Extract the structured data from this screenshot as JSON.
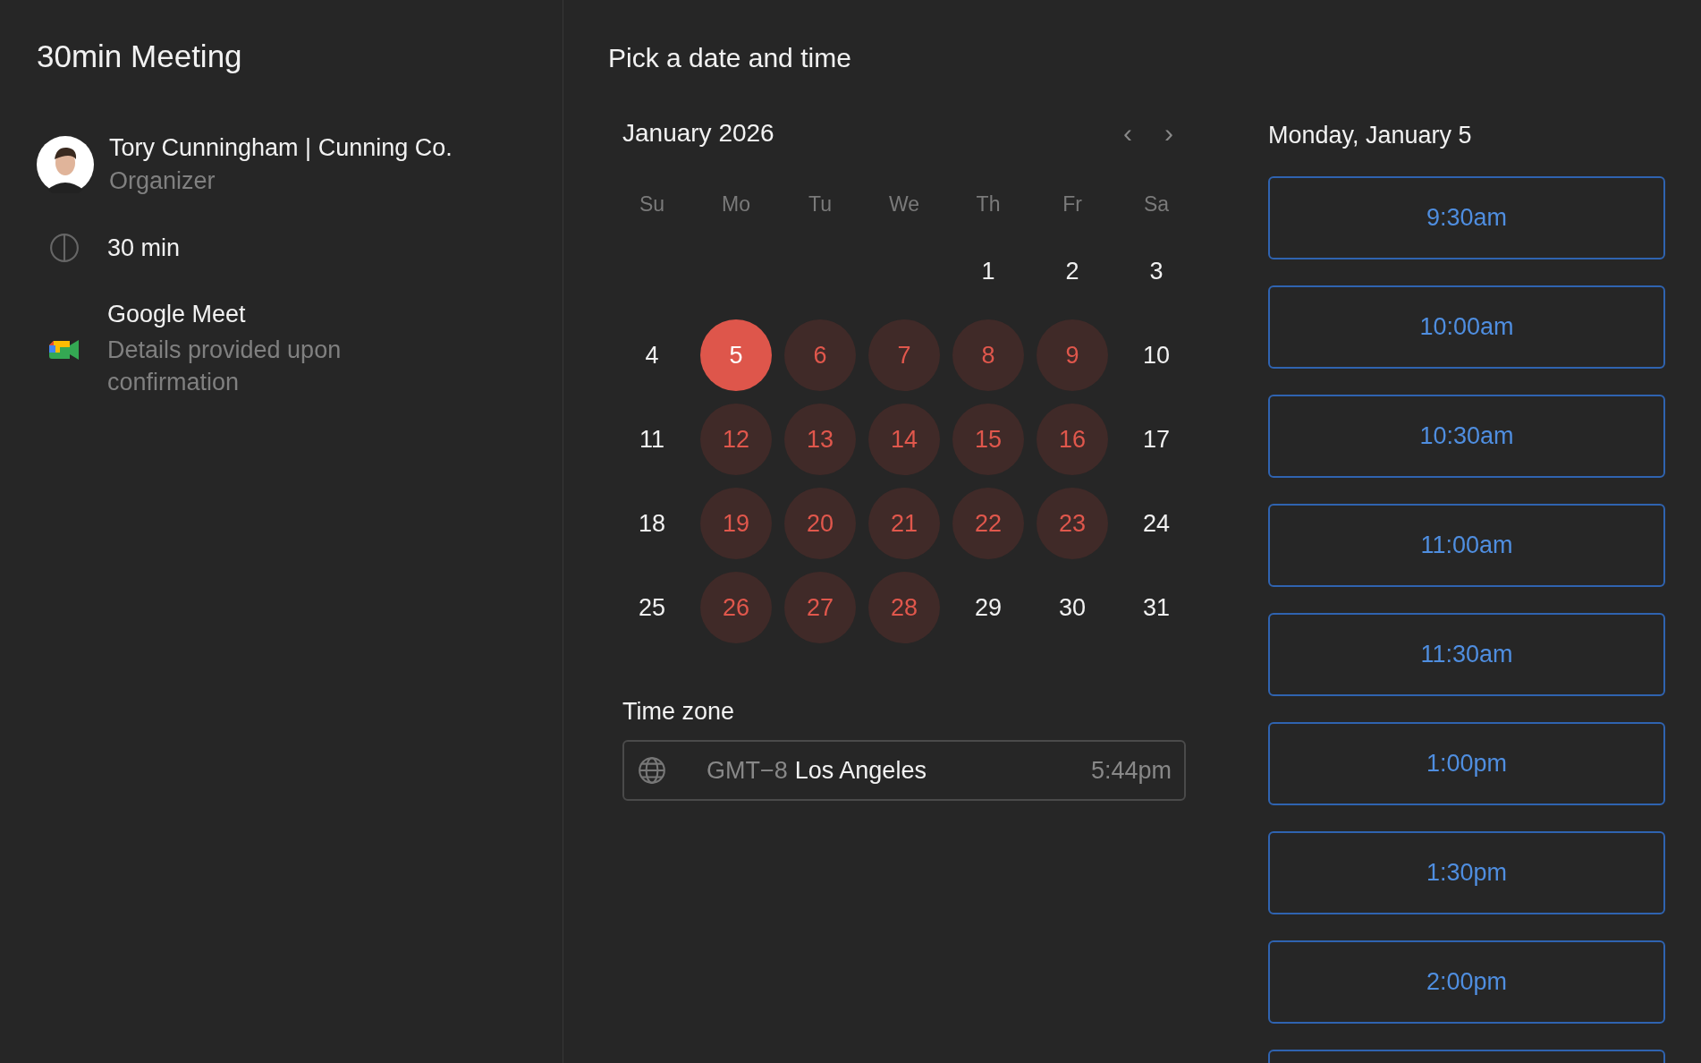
{
  "event": {
    "title": "30min Meeting",
    "organizer": {
      "name": "Tory Cunningham | Cunning Co.",
      "role": "Organizer"
    },
    "duration": "30 min",
    "location": {
      "name": "Google Meet",
      "note": "Details provided upon confirmation"
    }
  },
  "booking": {
    "title": "Pick a date and time",
    "calendar": {
      "month": "January 2026",
      "prev": "‹",
      "next": "›",
      "weekdays": [
        "Su",
        "Mo",
        "Tu",
        "We",
        "Th",
        "Fr",
        "Sa"
      ],
      "weeks": [
        [
          {
            "day": "1",
            "available": false,
            "selected": false
          },
          {
            "day": "2",
            "available": false,
            "selected": false
          },
          {
            "day": "3",
            "available": false,
            "selected": false
          }
        ],
        [
          {
            "day": "4",
            "available": false,
            "selected": false
          },
          {
            "day": "5",
            "available": true,
            "selected": true
          },
          {
            "day": "6",
            "available": true,
            "selected": false
          },
          {
            "day": "7",
            "available": true,
            "selected": false
          },
          {
            "day": "8",
            "available": true,
            "selected": false
          },
          {
            "day": "9",
            "available": true,
            "selected": false
          },
          {
            "day": "10",
            "available": false,
            "selected": false
          }
        ],
        [
          {
            "day": "11",
            "available": false,
            "selected": false
          },
          {
            "day": "12",
            "available": true,
            "selected": false
          },
          {
            "day": "13",
            "available": true,
            "selected": false
          },
          {
            "day": "14",
            "available": true,
            "selected": false
          },
          {
            "day": "15",
            "available": true,
            "selected": false
          },
          {
            "day": "16",
            "available": true,
            "selected": false
          },
          {
            "day": "17",
            "available": false,
            "selected": false
          }
        ],
        [
          {
            "day": "18",
            "available": false,
            "selected": false
          },
          {
            "day": "19",
            "available": true,
            "selected": false
          },
          {
            "day": "20",
            "available": true,
            "selected": false
          },
          {
            "day": "21",
            "available": true,
            "selected": false
          },
          {
            "day": "22",
            "available": true,
            "selected": false
          },
          {
            "day": "23",
            "available": true,
            "selected": false
          },
          {
            "day": "24",
            "available": false,
            "selected": false
          }
        ],
        [
          {
            "day": "25",
            "available": false,
            "selected": false
          },
          {
            "day": "26",
            "available": true,
            "selected": false
          },
          {
            "day": "27",
            "available": true,
            "selected": false
          },
          {
            "day": "28",
            "available": true,
            "selected": false
          },
          {
            "day": "29",
            "available": false,
            "selected": false
          },
          {
            "day": "30",
            "available": false,
            "selected": false
          },
          {
            "day": "31",
            "available": false,
            "selected": false
          }
        ]
      ]
    },
    "timezone": {
      "label": "Time zone",
      "offset": "GMT−8",
      "city": "Los Angeles",
      "local_time": "5:44pm"
    },
    "slots_heading": "Monday, January 5",
    "slots": [
      "9:30am",
      "10:00am",
      "10:30am",
      "11:00am",
      "11:30am",
      "1:00pm",
      "1:30pm",
      "2:00pm"
    ],
    "more_slots_below": true
  }
}
